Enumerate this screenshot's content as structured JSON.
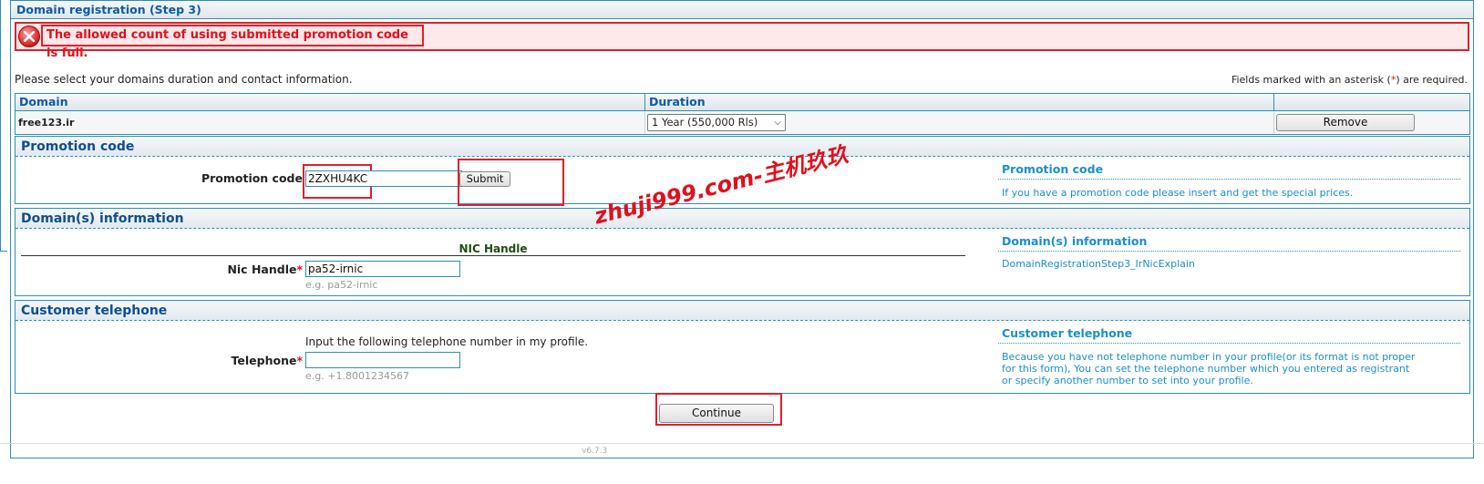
{
  "page": {
    "title": "Domain registration (Step 3)",
    "error_message": "The allowed count of using submitted promotion code is full.",
    "intro": "Please select your domains duration and contact information.",
    "required_note_pre": "Fields marked with an asterisk (",
    "required_star": "*",
    "required_note_post": ") are required."
  },
  "domains": {
    "headers": [
      "Domain",
      "Duration",
      ""
    ],
    "rows": [
      {
        "domain": "free123.ir",
        "duration": "1 Year (550,000 Rls)",
        "remove_label": "Remove"
      }
    ]
  },
  "promotion": {
    "heading": "Promotion code",
    "label": "Promotion code",
    "value": "2ZXHU4KC",
    "submit_label": "Submit",
    "side_title": "Promotion code",
    "side_text": "If you have a promotion code please insert and get the special prices."
  },
  "domain_info": {
    "heading": "Domain(s) information",
    "subheading": "NIC Handle",
    "label": "Nic Handle",
    "star": "*",
    "value": "pa52-irnic",
    "hint": "e.g. pa52-irnic",
    "side_title": "Domain(s) information",
    "side_text": "DomainRegistrationStep3_IrNicExplain"
  },
  "telephone": {
    "heading": "Customer telephone",
    "instruction": "Input the following telephone number in my profile.",
    "label": "Telephone",
    "star": "*",
    "value": "",
    "hint": "e.g. +1.8001234567",
    "side_title": "Customer telephone",
    "side_text": "Because you have not telephone number in your profile(or its format is not proper for this form), You can set the telephone number which you entered as registrant or specify another number to set into your profile."
  },
  "actions": {
    "continue_label": "Continue"
  },
  "watermark": "zhuji999.com-主机玖玖",
  "version": "v6.7.3",
  "colors": {
    "accent": "#2b91b4",
    "error": "#e0202c",
    "link": "#1a8fcf"
  }
}
